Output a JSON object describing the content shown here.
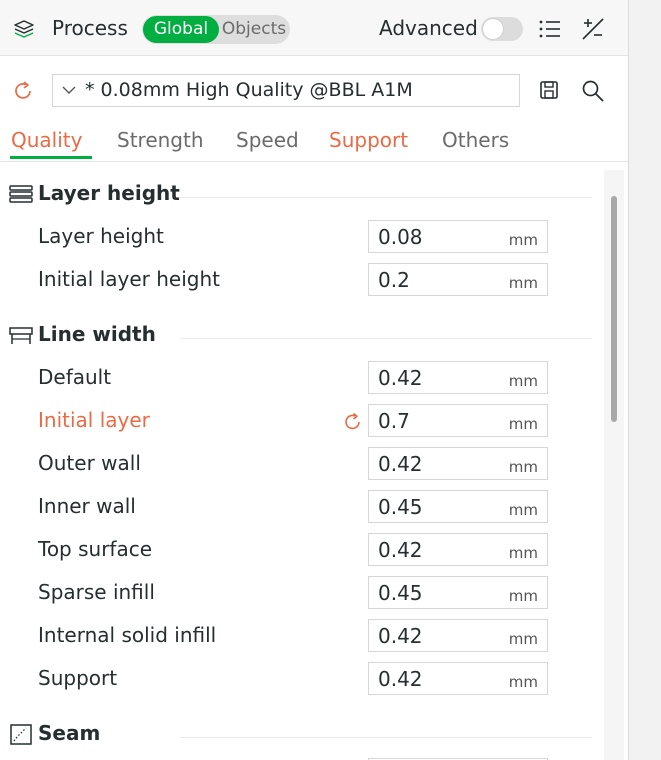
{
  "header": {
    "title": "Process",
    "scope_global": "Global",
    "scope_objects": "Objects",
    "advanced_label": "Advanced",
    "advanced_on": false,
    "accent": "#00ae42"
  },
  "preset": {
    "name": "* 0.08mm High Quality @BBL A1M"
  },
  "tabs": [
    {
      "label": "Quality",
      "active": true
    },
    {
      "label": "Strength"
    },
    {
      "label": "Speed"
    },
    {
      "label": "Support",
      "warning": true
    },
    {
      "label": "Others"
    }
  ],
  "sections": {
    "layer_height": {
      "title": "Layer height",
      "rows": [
        {
          "label": "Layer height",
          "value": "0.08",
          "unit": "mm"
        },
        {
          "label": "Initial layer height",
          "value": "0.2",
          "unit": "mm"
        }
      ]
    },
    "line_width": {
      "title": "Line width",
      "rows": [
        {
          "label": "Default",
          "value": "0.42",
          "unit": "mm"
        },
        {
          "label": "Initial layer",
          "value": "0.7",
          "unit": "mm",
          "modified": true
        },
        {
          "label": "Outer wall",
          "value": "0.42",
          "unit": "mm"
        },
        {
          "label": "Inner wall",
          "value": "0.45",
          "unit": "mm"
        },
        {
          "label": "Top surface",
          "value": "0.42",
          "unit": "mm"
        },
        {
          "label": "Sparse infill",
          "value": "0.45",
          "unit": "mm"
        },
        {
          "label": "Internal solid infill",
          "value": "0.42",
          "unit": "mm"
        },
        {
          "label": "Support",
          "value": "0.42",
          "unit": "mm"
        }
      ]
    },
    "seam": {
      "title": "Seam"
    }
  },
  "colors": {
    "accent_green": "#00ae42",
    "modified_orange": "#ea6a45"
  }
}
